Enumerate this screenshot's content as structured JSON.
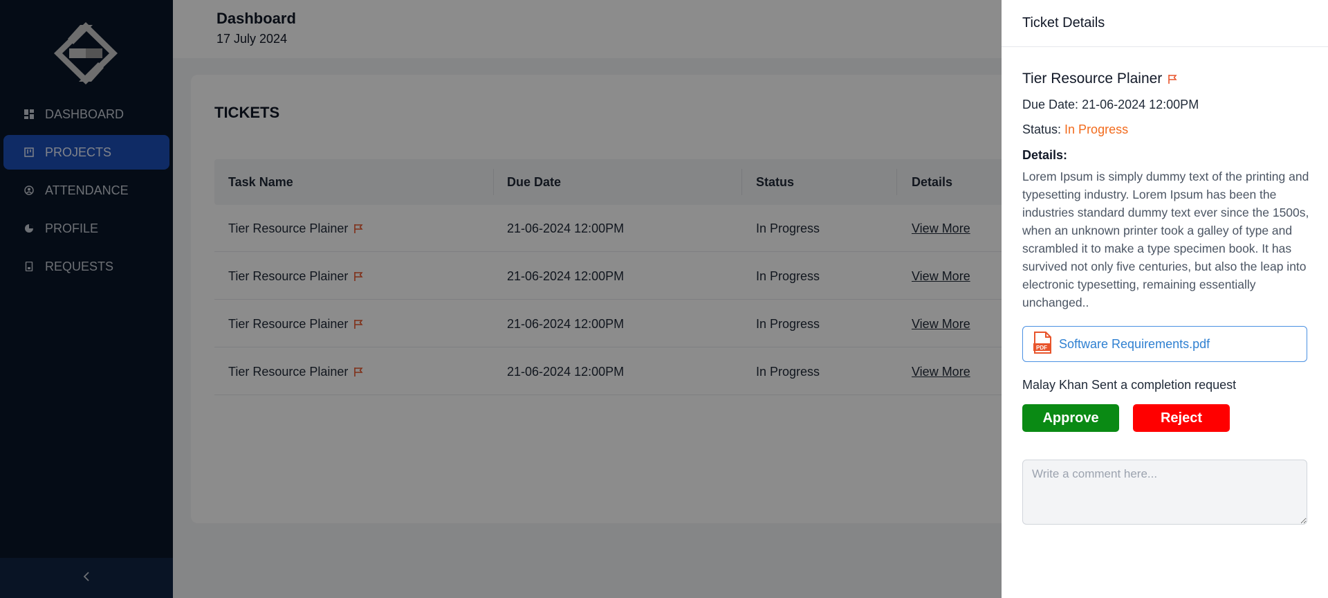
{
  "header": {
    "title": "Dashboard",
    "date": "17 July 2024"
  },
  "sidebar": {
    "logo": "app-logo",
    "items": [
      {
        "label": "DASHBOARD",
        "icon": "grid-icon",
        "active": false
      },
      {
        "label": "PROJECTS",
        "icon": "project-board-icon",
        "active": true
      },
      {
        "label": "ATTENDANCE",
        "icon": "user-circle-icon",
        "active": false
      },
      {
        "label": "PROFILE",
        "icon": "pie-chart-icon",
        "active": false
      },
      {
        "label": "REQUESTS",
        "icon": "document-icon",
        "active": false
      }
    ],
    "collapse_icon": "chevron-left-icon"
  },
  "tickets": {
    "title": "TICKETS",
    "columns": [
      "Task Name",
      "Due Date",
      "Status",
      "Details"
    ],
    "rows": [
      {
        "task": "Tier Resource Plainer",
        "due": "21-06-2024 12:00PM",
        "status": "In Progress",
        "details": "View More"
      },
      {
        "task": "Tier Resource Plainer",
        "due": "21-06-2024 12:00PM",
        "status": "In Progress",
        "details": "View More"
      },
      {
        "task": "Tier Resource Plainer",
        "due": "21-06-2024 12:00PM",
        "status": "In Progress",
        "details": "View More"
      },
      {
        "task": "Tier Resource Plainer",
        "due": "21-06-2024 12:00PM",
        "status": "In Progress",
        "details": "View More"
      }
    ]
  },
  "drawer": {
    "title": "Ticket Details",
    "task_name": "Tier Resource Plainer",
    "due_label": "Due Date:",
    "due_value": "21-06-2024 12:00PM",
    "status_label": "Status:",
    "status_value": "In Progress",
    "details_label": "Details:",
    "details_text": "Lorem Ipsum is simply dummy text of the printing and typesetting industry. Lorem Ipsum has been the industries standard dummy text ever since the 1500s, when an unknown printer took a galley of type and scrambled it to make a type specimen book. It has survived not only five centuries, but also the leap into electronic typesetting, remaining essentially unchanged..",
    "attachment": "Software Requirements.pdf",
    "request_text": "Malay Khan Sent a completion request",
    "approve_label": "Approve",
    "reject_label": "Reject",
    "comment_placeholder": "Write a comment here..."
  },
  "colors": {
    "sidebar_bg": "#0a1628",
    "active_nav": "#1d4fb8",
    "flag": "#e8542b",
    "status_in_progress": "#f26b1d",
    "approve": "#0a8a14",
    "reject": "#ff0000",
    "link": "#2f80d1"
  }
}
